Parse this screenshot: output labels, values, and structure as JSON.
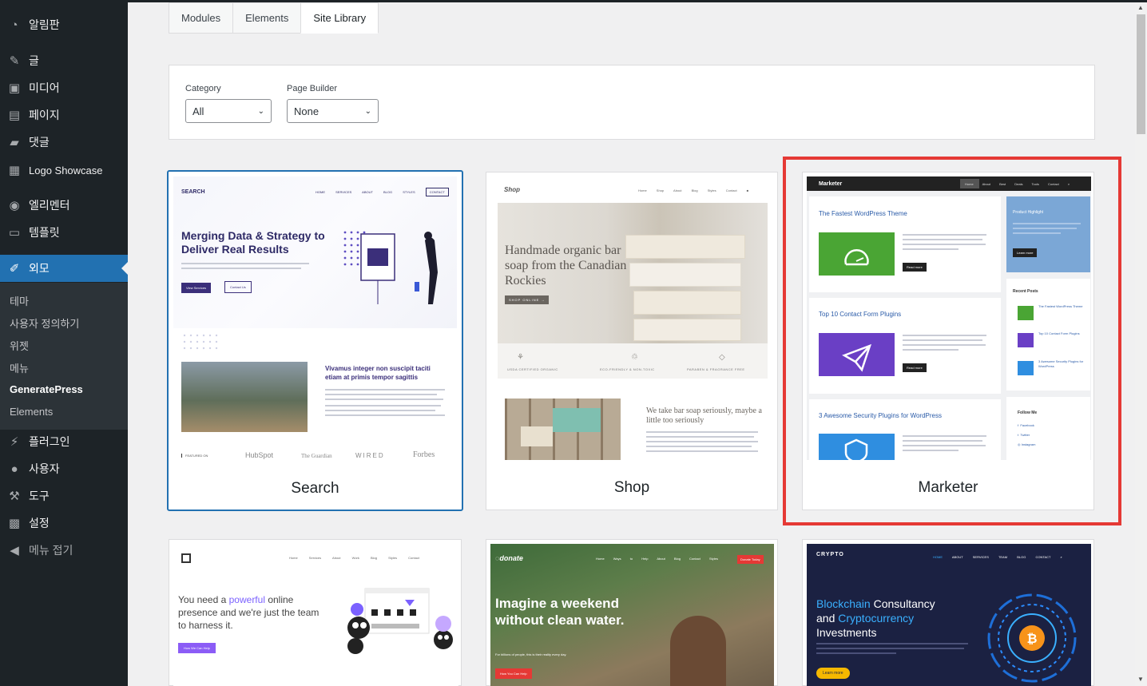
{
  "sidebar": {
    "items": [
      {
        "label": "알림판",
        "icon": "dashboard-icon"
      },
      {
        "label": "글",
        "icon": "pin-icon"
      },
      {
        "label": "미디어",
        "icon": "media-icon"
      },
      {
        "label": "페이지",
        "icon": "page-icon"
      },
      {
        "label": "댓글",
        "icon": "comment-icon"
      },
      {
        "label": "Logo Showcase",
        "icon": "images-icon"
      },
      {
        "label": "엘리멘터",
        "icon": "elementor-icon"
      },
      {
        "label": "템플릿",
        "icon": "folder-icon"
      },
      {
        "label": "외모",
        "icon": "brush-icon"
      },
      {
        "label": "플러그인",
        "icon": "plugin-icon"
      },
      {
        "label": "사용자",
        "icon": "user-icon"
      },
      {
        "label": "도구",
        "icon": "wrench-icon"
      },
      {
        "label": "설정",
        "icon": "settings-icon"
      }
    ],
    "submenu": [
      "테마",
      "사용자 정의하기",
      "위젯",
      "메뉴",
      "GeneratePress",
      "Elements"
    ],
    "collapse_label": "메뉴 접기"
  },
  "tabs": [
    "Modules",
    "Elements",
    "Site Library"
  ],
  "filters": {
    "category_label": "Category",
    "category_value": "All",
    "builder_label": "Page Builder",
    "builder_value": "None"
  },
  "cards": [
    {
      "title": "Search",
      "logo": "SEARCH",
      "nav": [
        "HOME",
        "SERVICES",
        "ABOUT",
        "BLOG",
        "STYLES",
        "CONTACT"
      ],
      "headline": "Merging Data & Strategy to Deliver Real Results",
      "btn1": "View Services",
      "btn2": "Contact Us",
      "subhead": "Vivamus integer non suscipit taciti etiam at primis tempor sagittis",
      "featured": "FEATURED ON",
      "brands": [
        "HubSpot",
        "The Guardian",
        "WIRED",
        "Forbes"
      ]
    },
    {
      "title": "Shop",
      "logo": "Shop",
      "nav": [
        "Home",
        "Shop",
        "About",
        "Blog",
        "Styles",
        "Contact"
      ],
      "headline": "Handmade organic bar soap from the Canadian Rockies",
      "btn": "SHOP ONLINE →",
      "features": [
        "USDA CERTIFIED ORGANIC",
        "ECO-FRIENDLY & NON-TOXIC",
        "PARABEN & FRAGRANCE FREE"
      ],
      "tagline": "We take bar soap seriously, maybe a little too seriously"
    },
    {
      "title": "Marketer",
      "logo": "Marketer",
      "nav": [
        "Home",
        "About",
        "Best Deals",
        "Tools",
        "Contact"
      ],
      "posts": [
        "The Fastest WordPress Theme",
        "Top 10 Contact Form Plugins",
        "3 Awesome Security Plugins for WordPress"
      ],
      "read_more": "Read more",
      "product_highlight": "Product Highlight",
      "learn_more": "Learn more",
      "recent_posts": "Recent Posts",
      "recent_items": [
        "The Fastest WordPress Theme",
        "Top 10 Contact Form Plugins",
        "3 Awesome Security Plugins for WordPress"
      ],
      "follow_me": "Follow Me",
      "socials": [
        "Facebook",
        "Twitter",
        "Instagram"
      ]
    },
    {
      "title": "",
      "nav": [
        "Home",
        "Services",
        "About",
        "Work",
        "Blog",
        "Styles",
        "Contact"
      ],
      "text_a": "You need a ",
      "text_b": "powerful",
      "text_c": " online presence and we're just the team to harness it.",
      "btn": "How We Can Help"
    },
    {
      "title": "",
      "logo": "donate",
      "nav": [
        "Home",
        "Ways to Help",
        "About",
        "Blog",
        "Contact",
        "Styles"
      ],
      "nav_btn": "Donate Today",
      "headline": "Imagine a weekend without clean water.",
      "sub": "For billions of people, this is their reality every day.",
      "btn": "How You Can Help"
    },
    {
      "title": "",
      "logo": "CRYPTO",
      "nav": [
        "HOME",
        "ABOUT",
        "SERVICES",
        "TEAM",
        "BLOG",
        "CONTACT"
      ],
      "headline_a": "Blockchain ",
      "headline_b": "Consultancy",
      "headline_c": "and ",
      "headline_d": "Cryptocurrency",
      "headline_e": "Investments",
      "btn": "Learn more"
    }
  ],
  "colors": {
    "sidebar_bg": "#1d2327",
    "accent": "#2271b1",
    "highlight": "#e53935"
  }
}
